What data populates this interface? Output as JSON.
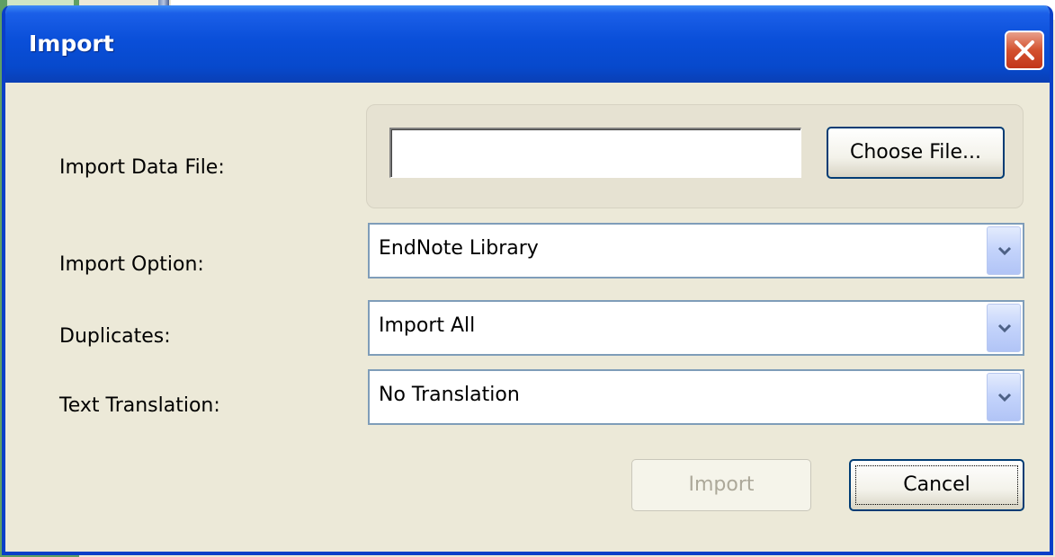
{
  "dialog": {
    "title": "Import"
  },
  "form": {
    "import_data_file": {
      "label": "Import Data File:",
      "value": "",
      "choose_button": "Choose File..."
    },
    "import_option": {
      "label": "Import Option:",
      "selected": "EndNote Library"
    },
    "duplicates": {
      "label": "Duplicates:",
      "selected": "Import All"
    },
    "text_translation": {
      "label": "Text Translation:",
      "selected": "No Translation"
    }
  },
  "buttons": {
    "import": "Import",
    "import_enabled": false,
    "cancel": "Cancel"
  },
  "colors": {
    "titlebar": "#0a4fd9",
    "dialog_bg": "#ece9d8",
    "close_button": "#d3512f",
    "disabled_text": "#aca899"
  },
  "icons": {
    "close": "close-x-icon",
    "dropdown": "chevron-down-icon"
  }
}
